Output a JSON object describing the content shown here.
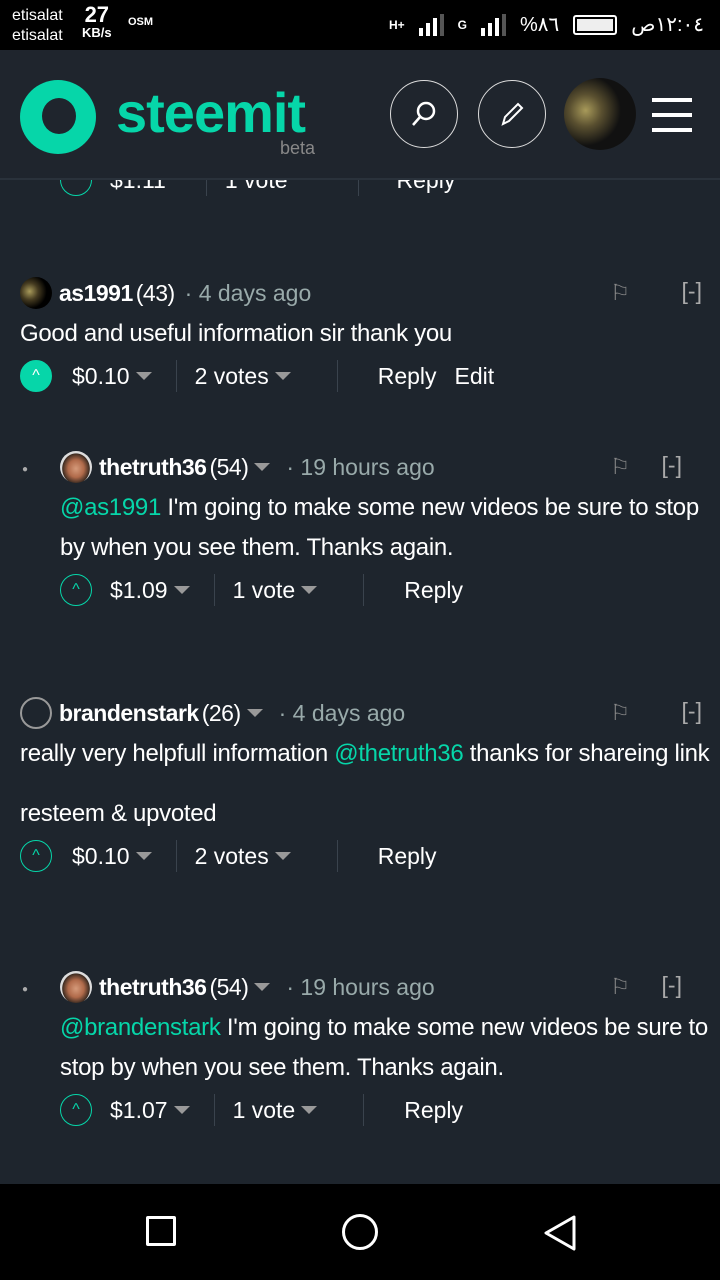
{
  "status_bar": {
    "carrier1": "etisalat",
    "carrier2": "etisalat",
    "speed": "27",
    "speed_unit": "KB/s",
    "osm": "OSM",
    "net1": "H+",
    "net2": "G",
    "battery": "%٨٦",
    "time": "١٢:٠٤ص"
  },
  "header": {
    "logo": "steemit",
    "beta": "beta",
    "accent": "#06d6a9"
  },
  "partial": {
    "payout": "$1.11",
    "votes": "1 vote",
    "reply": "Reply"
  },
  "comments": [
    {
      "user": "as1991",
      "rep": "(43)",
      "time": "· 4 days ago",
      "body": "Good and useful information sir thank you",
      "payout": "$0.10",
      "votes": "2 votes",
      "reply": "Reply",
      "edit": "Edit",
      "collapse": "[-]"
    },
    {
      "user": "thetruth36",
      "rep": "(54)",
      "time": "· 19 hours ago",
      "mention": "@as1991",
      "body": " I'm going to make some new videos be sure to stop by when you see them. Thanks again.",
      "payout": "$1.09",
      "votes": "1 vote",
      "reply": "Reply",
      "collapse": "[-]"
    },
    {
      "user": "brandenstark",
      "rep": "(26)",
      "time": "· 4 days ago",
      "body1": "really very helpfull information ",
      "mention": "@thetruth36",
      "body2": " thanks for shareing link",
      "body3": "resteem & upvoted",
      "payout": "$0.10",
      "votes": "2 votes",
      "reply": "Reply",
      "collapse": "[-]"
    },
    {
      "user": "thetruth36",
      "rep": "(54)",
      "time": "· 19 hours ago",
      "mention": "@brandenstark",
      "body": " I'm going to make some new videos be sure to stop by when you see them. Thanks again.",
      "payout": "$1.07",
      "votes": "1 vote",
      "reply": "Reply",
      "collapse": "[-]"
    }
  ]
}
